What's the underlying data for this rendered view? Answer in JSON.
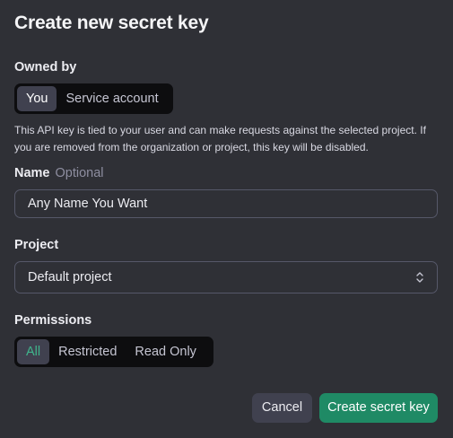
{
  "dialog": {
    "title": "Create new secret key",
    "owned_by": {
      "label": "Owned by",
      "options": [
        "You",
        "Service account"
      ],
      "selected": "You"
    },
    "description": "This API key is tied to your user and can make requests against the selected project. If you are removed from the organization or project, this key will be disabled.",
    "name": {
      "label": "Name",
      "optional_label": "Optional",
      "value": "Any Name You Want"
    },
    "project": {
      "label": "Project",
      "selected": "Default project",
      "icon": "chevron-up-down-icon"
    },
    "permissions": {
      "label": "Permissions",
      "options": [
        "All",
        "Restricted",
        "Read Only"
      ],
      "selected": "All"
    },
    "buttons": {
      "cancel": "Cancel",
      "create": "Create secret key"
    }
  },
  "colors": {
    "background": "#2f3036",
    "segment_bg": "#0d0d0f",
    "segment_active": "#40414f",
    "accent_green": "#1f8a65",
    "active_text_green": "#3fb58c",
    "border": "#565869"
  }
}
